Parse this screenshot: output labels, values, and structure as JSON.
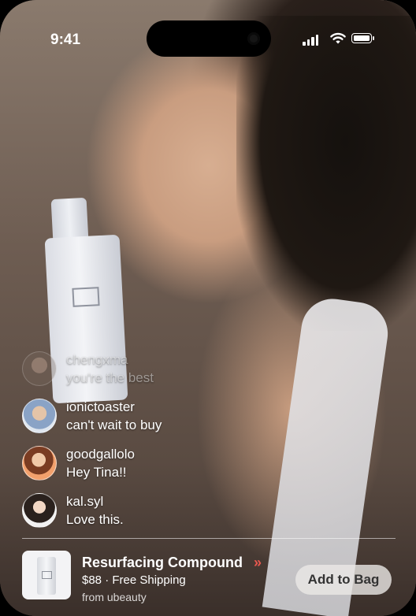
{
  "status_bar": {
    "time": "9:41",
    "signal_icon": "cellular-signal-icon",
    "wifi_icon": "wifi-icon",
    "battery_icon": "battery-icon"
  },
  "comments": [
    {
      "username": "chengxma",
      "message": "you're the best",
      "avatar_icon": "avatar"
    },
    {
      "username": "ionictoaster",
      "message": "can't wait to buy",
      "avatar_icon": "avatar"
    },
    {
      "username": "goodgallolo",
      "message": "Hey Tina!!",
      "avatar_icon": "avatar"
    },
    {
      "username": "kal.syl",
      "message": "Love this.",
      "avatar_icon": "avatar"
    }
  ],
  "product": {
    "name": "Resurfacing Compound",
    "price_shipping": "$88 · Free Shipping",
    "seller": "from ubeauty",
    "chevron": "»",
    "add_button": "Add to Bag",
    "accent_color": "#e8584f"
  }
}
